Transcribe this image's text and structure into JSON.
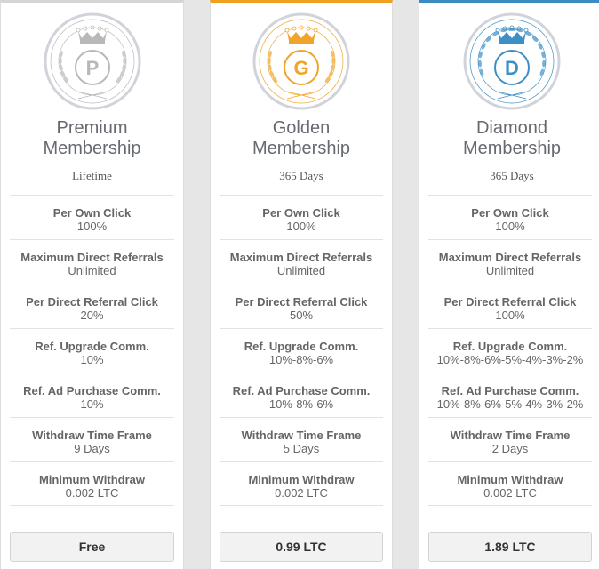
{
  "plans": [
    {
      "badge_letter": "P",
      "badge_color": "#b8b8b8",
      "accent_color": "#d5d5d5",
      "title_line1": "Premium",
      "title_line2": "Membership",
      "duration": "Lifetime",
      "features": [
        {
          "label": "Per Own Click",
          "value": "100%"
        },
        {
          "label": "Maximum Direct Referrals",
          "value": "Unlimited"
        },
        {
          "label": "Per Direct Referral Click",
          "value": "20%"
        },
        {
          "label": "Ref. Upgrade Comm.",
          "value": "10%"
        },
        {
          "label": "Ref. Ad Purchase Comm.",
          "value": "10%"
        },
        {
          "label": "Withdraw Time Frame",
          "value": "9 Days"
        },
        {
          "label": "Minimum Withdraw",
          "value": "0.002 LTC"
        }
      ],
      "price": "Free"
    },
    {
      "badge_letter": "G",
      "badge_color": "#f0a42a",
      "accent_color": "#f0a020",
      "title_line1": "Golden",
      "title_line2": "Membership",
      "duration": "365 Days",
      "features": [
        {
          "label": "Per Own Click",
          "value": "100%"
        },
        {
          "label": "Maximum Direct Referrals",
          "value": "Unlimited"
        },
        {
          "label": "Per Direct Referral Click",
          "value": "50%"
        },
        {
          "label": "Ref. Upgrade Comm.",
          "value": "10%-8%-6%"
        },
        {
          "label": "Ref. Ad Purchase Comm.",
          "value": "10%-8%-6%"
        },
        {
          "label": "Withdraw Time Frame",
          "value": "5 Days"
        },
        {
          "label": "Minimum Withdraw",
          "value": "0.002 LTC"
        }
      ],
      "price": "0.99 LTC"
    },
    {
      "badge_letter": "D",
      "badge_color": "#3d8fc6",
      "accent_color": "#3a8cc0",
      "title_line1": "Diamond",
      "title_line2": "Membership",
      "duration": "365 Days",
      "features": [
        {
          "label": "Per Own Click",
          "value": "100%"
        },
        {
          "label": "Maximum Direct Referrals",
          "value": "Unlimited"
        },
        {
          "label": "Per Direct Referral Click",
          "value": "100%"
        },
        {
          "label": "Ref. Upgrade Comm.",
          "value": "10%-8%-6%-5%-4%-3%-2%"
        },
        {
          "label": "Ref. Ad Purchase Comm.",
          "value": "10%-8%-6%-5%-4%-3%-2%"
        },
        {
          "label": "Withdraw Time Frame",
          "value": "2 Days"
        },
        {
          "label": "Minimum Withdraw",
          "value": "0.002 LTC"
        }
      ],
      "price": "1.89 LTC"
    }
  ]
}
